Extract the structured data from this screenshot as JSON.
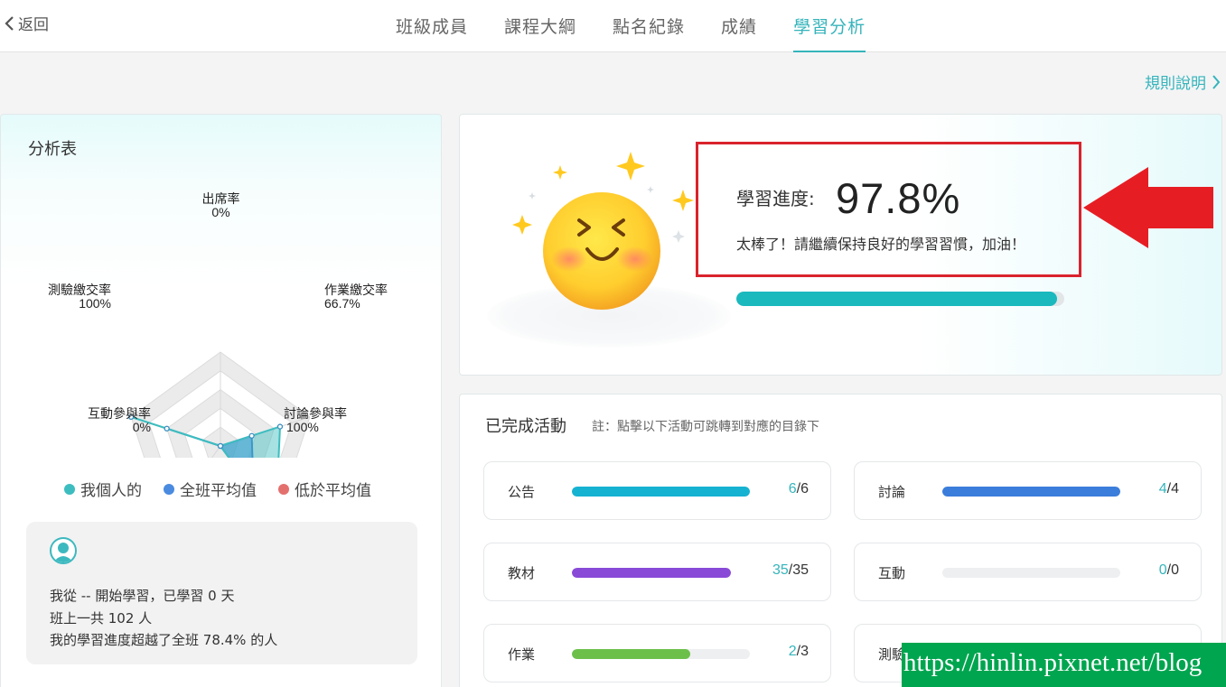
{
  "nav": {
    "back_label": "返回",
    "tabs": [
      {
        "label": "班級成員"
      },
      {
        "label": "課程大綱"
      },
      {
        "label": "點名紀錄"
      },
      {
        "label": "成績"
      },
      {
        "label": "學習分析",
        "active": true
      }
    ],
    "rules_label": "規則說明"
  },
  "analysis": {
    "title": "分析表",
    "radar": {
      "axes": [
        {
          "label": "出席率",
          "value": "0%",
          "personal": 0
        },
        {
          "label": "作業繳交率",
          "value": "66.7%",
          "personal": 66.7
        },
        {
          "label": "討論參與率",
          "value": "100%",
          "personal": 100
        },
        {
          "label": "互動參與率",
          "value": "0%",
          "personal": 0
        },
        {
          "label": "測驗繳交率",
          "value": "100%",
          "personal": 100
        }
      ],
      "class_average_shape": [
        0,
        35,
        60,
        0,
        60
      ]
    },
    "legend": [
      {
        "label": "我個人的",
        "color": "#3dbdbf"
      },
      {
        "label": "全班平均值",
        "color": "#4a8be0"
      },
      {
        "label": "低於平均值",
        "color": "#e4706e"
      }
    ],
    "info": {
      "line1": "我從 -- 開始學習，已學習 0 天",
      "line2": "班上一共 102 人",
      "line3": "我的學習進度超越了全班 78.4% 的人"
    }
  },
  "progress": {
    "label": "學習進度:",
    "value": "97.8%",
    "percent": 97.8,
    "message": "太棒了！請繼續保持良好的學習習慣，加油！"
  },
  "activities": {
    "title": "已完成活動",
    "note": "註：點擊以下活動可跳轉到對應的目錄下",
    "items": [
      {
        "name": "公告",
        "done": "6",
        "total": "/6",
        "percent": 100,
        "color": "#16b2d1"
      },
      {
        "name": "討論",
        "done": "4",
        "total": "/4",
        "percent": 100,
        "color": "#3b7ddb"
      },
      {
        "name": "教材",
        "done": "35",
        "total": "/35",
        "percent": 100,
        "color": "#8a4ad8"
      },
      {
        "name": "互動",
        "done": "0",
        "total": "/0",
        "percent": 0,
        "color": "#bbbbbb"
      },
      {
        "name": "作業",
        "done": "2",
        "total": "/3",
        "percent": 66.7,
        "color": "#6cc04a"
      },
      {
        "name": "測驗",
        "done": "",
        "total": "",
        "percent": 0,
        "color": "#bbbbbb"
      }
    ]
  },
  "watermark": "https://hinlin.pixnet.net/blog"
}
